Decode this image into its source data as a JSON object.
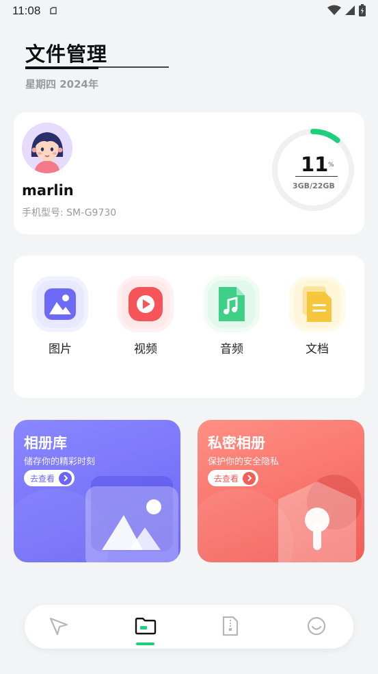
{
  "status_bar": {
    "time": "11:08"
  },
  "header": {
    "title": "文件管理",
    "date": "星期四  2024年"
  },
  "user": {
    "name": "marlin",
    "model_label": "手机型号: ",
    "model_value": "SM-G9730",
    "storage_percent": "11",
    "storage_percent_sign": "%",
    "storage_text": "3GB/22GB"
  },
  "categories": [
    {
      "label": "图片",
      "icon": "image-icon",
      "color": "#6d6af8"
    },
    {
      "label": "视频",
      "icon": "video-play-icon",
      "color": "#f5545a"
    },
    {
      "label": "音频",
      "icon": "music-note-icon",
      "color": "#3fcf86"
    },
    {
      "label": "文档",
      "icon": "document-icon",
      "color": "#f6c63c"
    }
  ],
  "promos": {
    "album": {
      "title": "相册库",
      "subtitle": "储存你的精彩时刻",
      "button": "去查看",
      "accent": "#6b66f5"
    },
    "private": {
      "title": "私密相册",
      "subtitle": "保护你的安全隐私",
      "button": "去查看",
      "accent": "#f25d57"
    }
  },
  "tabs": [
    {
      "name": "send-icon",
      "active": false
    },
    {
      "name": "folder-icon",
      "active": true
    },
    {
      "name": "zip-file-icon",
      "active": false
    },
    {
      "name": "smile-icon",
      "active": false
    }
  ],
  "colors": {
    "accent": "#1fcf7d",
    "background": "#f3f4f6"
  }
}
